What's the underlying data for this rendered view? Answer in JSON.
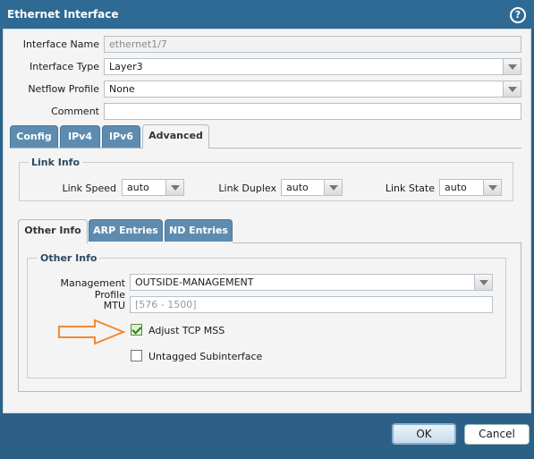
{
  "window": {
    "title": "Ethernet Interface",
    "help_icon": "help-icon"
  },
  "form": {
    "interface_name": {
      "label": "Interface Name",
      "value": "ethernet1/7"
    },
    "interface_type": {
      "label": "Interface Type",
      "value": "Layer3"
    },
    "netflow_profile": {
      "label": "Netflow Profile",
      "value": "None"
    },
    "comment": {
      "label": "Comment",
      "value": ""
    }
  },
  "tabs": [
    "Config",
    "IPv4",
    "IPv6",
    "Advanced"
  ],
  "link_info": {
    "title": "Link Info",
    "speed": {
      "label": "Link Speed",
      "value": "auto"
    },
    "duplex": {
      "label": "Link Duplex",
      "value": "auto"
    },
    "state": {
      "label": "Link State",
      "value": "auto"
    }
  },
  "subtabs": [
    "Other Info",
    "ARP Entries",
    "ND Entries"
  ],
  "other_info": {
    "title": "Other Info",
    "management_profile": {
      "label": "Management Profile",
      "value": "OUTSIDE-MANAGEMENT"
    },
    "mtu": {
      "label": "MTU",
      "placeholder": "[576 - 1500]"
    },
    "adjust_tcp_mss": {
      "label": "Adjust TCP MSS",
      "checked": true
    },
    "untagged_subinterface": {
      "label": "Untagged Subinterface",
      "checked": false
    }
  },
  "annotation": {
    "color": "#f28a2e",
    "icon": "arrow-right-icon"
  },
  "buttons": {
    "ok": "OK",
    "cancel": "Cancel"
  }
}
